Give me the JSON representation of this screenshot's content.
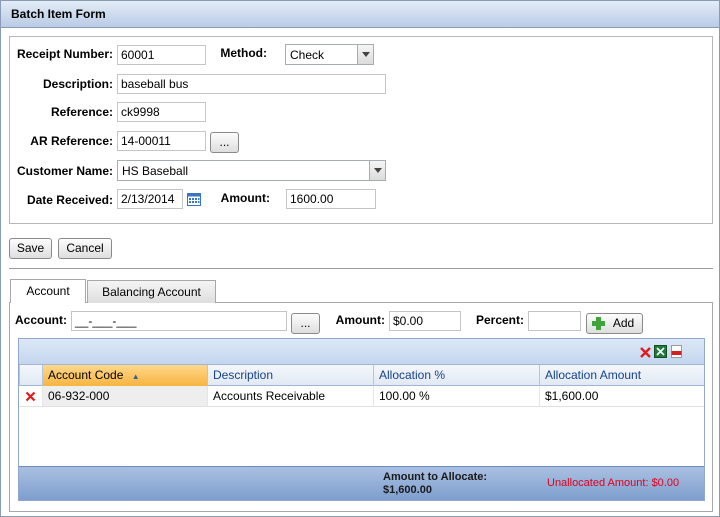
{
  "window": {
    "title": "Batch Item Form"
  },
  "form": {
    "receipt_number_label": "Receipt Number:",
    "receipt_number": "60001",
    "method_label": "Method:",
    "method_value": "Check",
    "description_label": "Description:",
    "description": "baseball bus",
    "reference_label": "Reference:",
    "reference": "ck9998",
    "ar_reference_label": "AR Reference:",
    "ar_reference": "14-00011",
    "ellipsis_label": "...",
    "customer_name_label": "Customer Name:",
    "customer_name": "HS Baseball",
    "date_received_label": "Date Received:",
    "date_received": "2/13/2014",
    "amount_label": "Amount:",
    "amount": "1600.00"
  },
  "actions": {
    "save_label": "Save",
    "cancel_label": "Cancel"
  },
  "tabs": [
    {
      "label": "Account",
      "active": true
    },
    {
      "label": "Balancing Account",
      "active": false
    }
  ],
  "allocation": {
    "account_label": "Account:",
    "account_value": "__-___-___",
    "ellipsis_label": "...",
    "amount_label": "Amount:",
    "amount_value": "$0.00",
    "percent_label": "Percent:",
    "percent_value": "",
    "add_label": "Add"
  },
  "grid": {
    "columns": [
      "Account Code",
      "Description",
      "Allocation %",
      "Allocation Amount"
    ],
    "sorted_column": "Account Code",
    "rows": [
      {
        "account_code": "06-932-000",
        "description": "Accounts Receivable",
        "allocation_pct": "100.00 %",
        "allocation_amount": "$1,600.00"
      }
    ],
    "footer": {
      "amount_to_allocate_label": "Amount to Allocate:",
      "amount_to_allocate_value": "$1,600.00",
      "unallocated": "Unallocated Amount: $0.00"
    }
  },
  "colors": {
    "titlebar": "#b9cbe6",
    "header_sorted": "#f7b441",
    "footer": "#7f9fcf",
    "unallocated_text": "#e0001c"
  }
}
